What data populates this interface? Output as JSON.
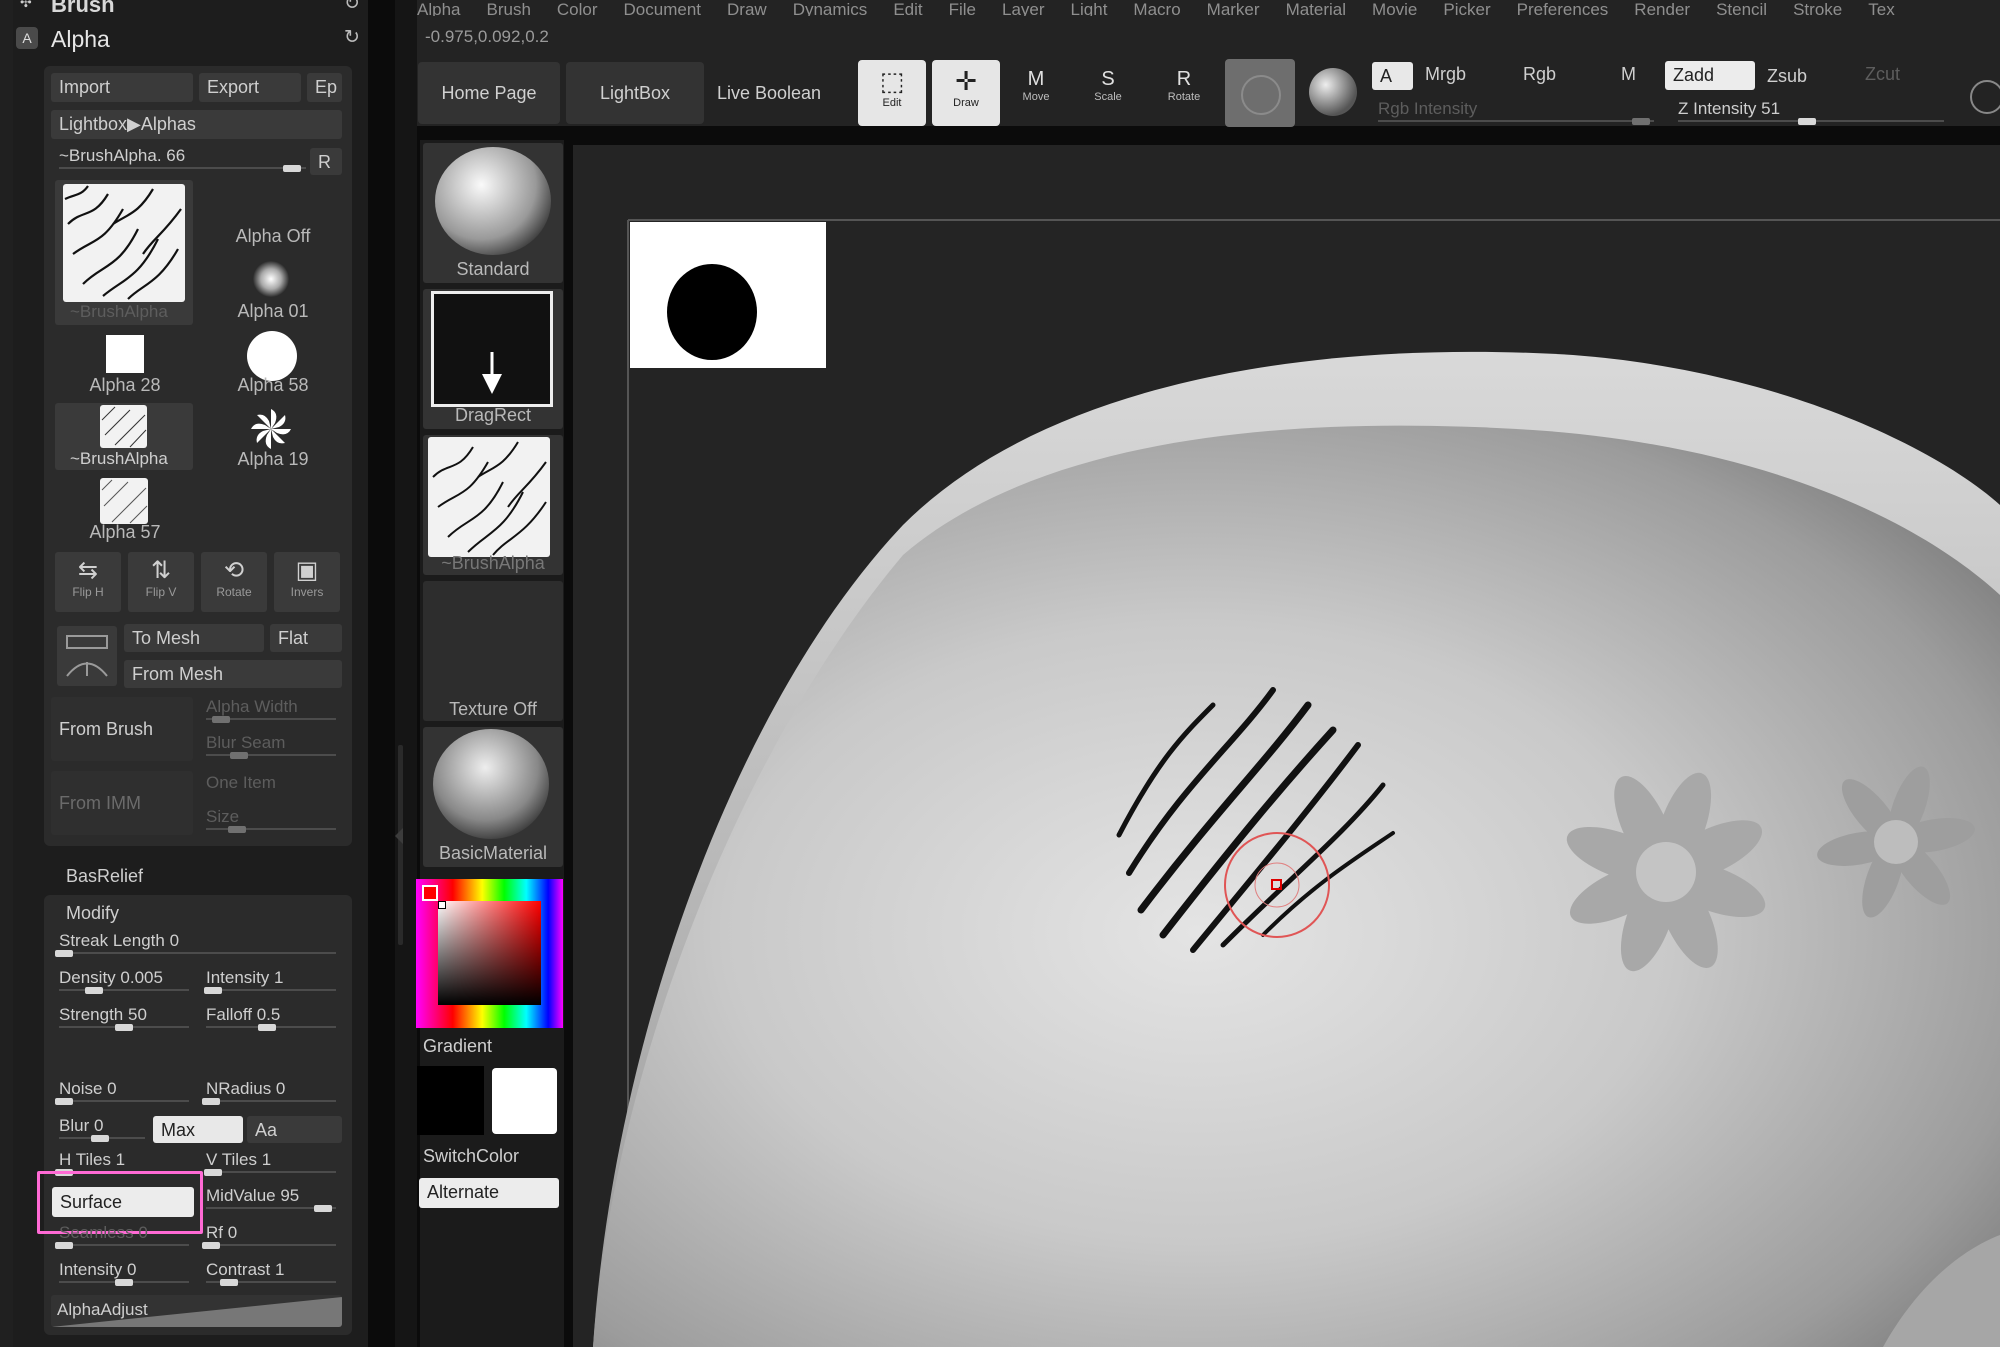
{
  "menu": [
    "Alpha",
    "Brush",
    "Color",
    "Document",
    "Draw",
    "Dynamics",
    "Edit",
    "File",
    "Layer",
    "Light",
    "Macro",
    "Marker",
    "Material",
    "Movie",
    "Picker",
    "Preferences",
    "Render",
    "Stencil",
    "Stroke",
    "Tex"
  ],
  "coords": "-0.975,0.092,0.2",
  "panel": {
    "brush_header": "Brush",
    "alpha_header": "Alpha",
    "import": "Import",
    "export": "Export",
    "ep": "Ep",
    "lightbox_alphas": "Lightbox▶Alphas",
    "brushalpha_slider": "~BrushAlpha. 66",
    "r_button": "R",
    "alpha_items": [
      {
        "label": "~BrushAlpha"
      },
      {
        "label": "Alpha Off"
      },
      {
        "label": "Alpha 01"
      },
      {
        "label": "Alpha 28"
      },
      {
        "label": "Alpha 58"
      },
      {
        "label": "~BrushAlpha"
      },
      {
        "label": "Alpha 19"
      },
      {
        "label": "Alpha 57"
      }
    ],
    "icon_buttons": [
      "Flip H",
      "Flip V",
      "Rotate",
      "Invers"
    ],
    "to_mesh": "To Mesh",
    "flat": "Flat",
    "from_mesh": "From Mesh",
    "from_brush": "From Brush",
    "from_imm": "From IMM",
    "alpha_width": "Alpha Width",
    "blur_seam": "Blur Seam",
    "one_item": "One Item",
    "size": "Size",
    "basrelief": "BasRelief",
    "modify": "Modify",
    "streak_length": "Streak Length 0",
    "density": "Density 0.005",
    "intensity": "Intensity 1",
    "strength": "Strength 50",
    "falloff": "Falloff 0.5",
    "noise": "Noise 0",
    "nradius": "NRadius 0",
    "blur": "Blur 0",
    "max": "Max",
    "aa": "Aa",
    "htiles": "H Tiles 1",
    "vtiles": "V Tiles 1",
    "surface": "Surface",
    "midvalue": "MidValue 95",
    "seamless": "Seamless 0",
    "rf": "Rf 0",
    "intensity2": "Intensity 0",
    "contrast": "Contrast 1",
    "alphaadjust": "AlphaAdjust"
  },
  "toolbar": {
    "home_page": "Home Page",
    "lightbox": "LightBox",
    "live_boolean": "Live Boolean",
    "edit": "Edit",
    "draw": "Draw",
    "move": "Move",
    "scale": "Scale",
    "rotate": "Rotate",
    "a": "A",
    "mrgb": "Mrgb",
    "rgb": "Rgb",
    "m": "M",
    "zadd": "Zadd",
    "zsub": "Zsub",
    "zcut": "Zcut",
    "rgb_intensity": "Rgb Intensity",
    "z_intensity": "Z Intensity 51",
    "z_intensity_value": 51
  },
  "shelf": {
    "standard": "Standard",
    "dragrect": "DragRect",
    "brushalpha": "~BrushAlpha",
    "texture_off": "Texture Off",
    "basic_material": "BasicMaterial",
    "gradient": "Gradient",
    "switchcolor": "SwitchColor",
    "alternate": "Alternate"
  },
  "colors": {
    "highlight": "#ff6ad5",
    "panel": "#2b2b2b",
    "button": "#3a3a3a"
  }
}
